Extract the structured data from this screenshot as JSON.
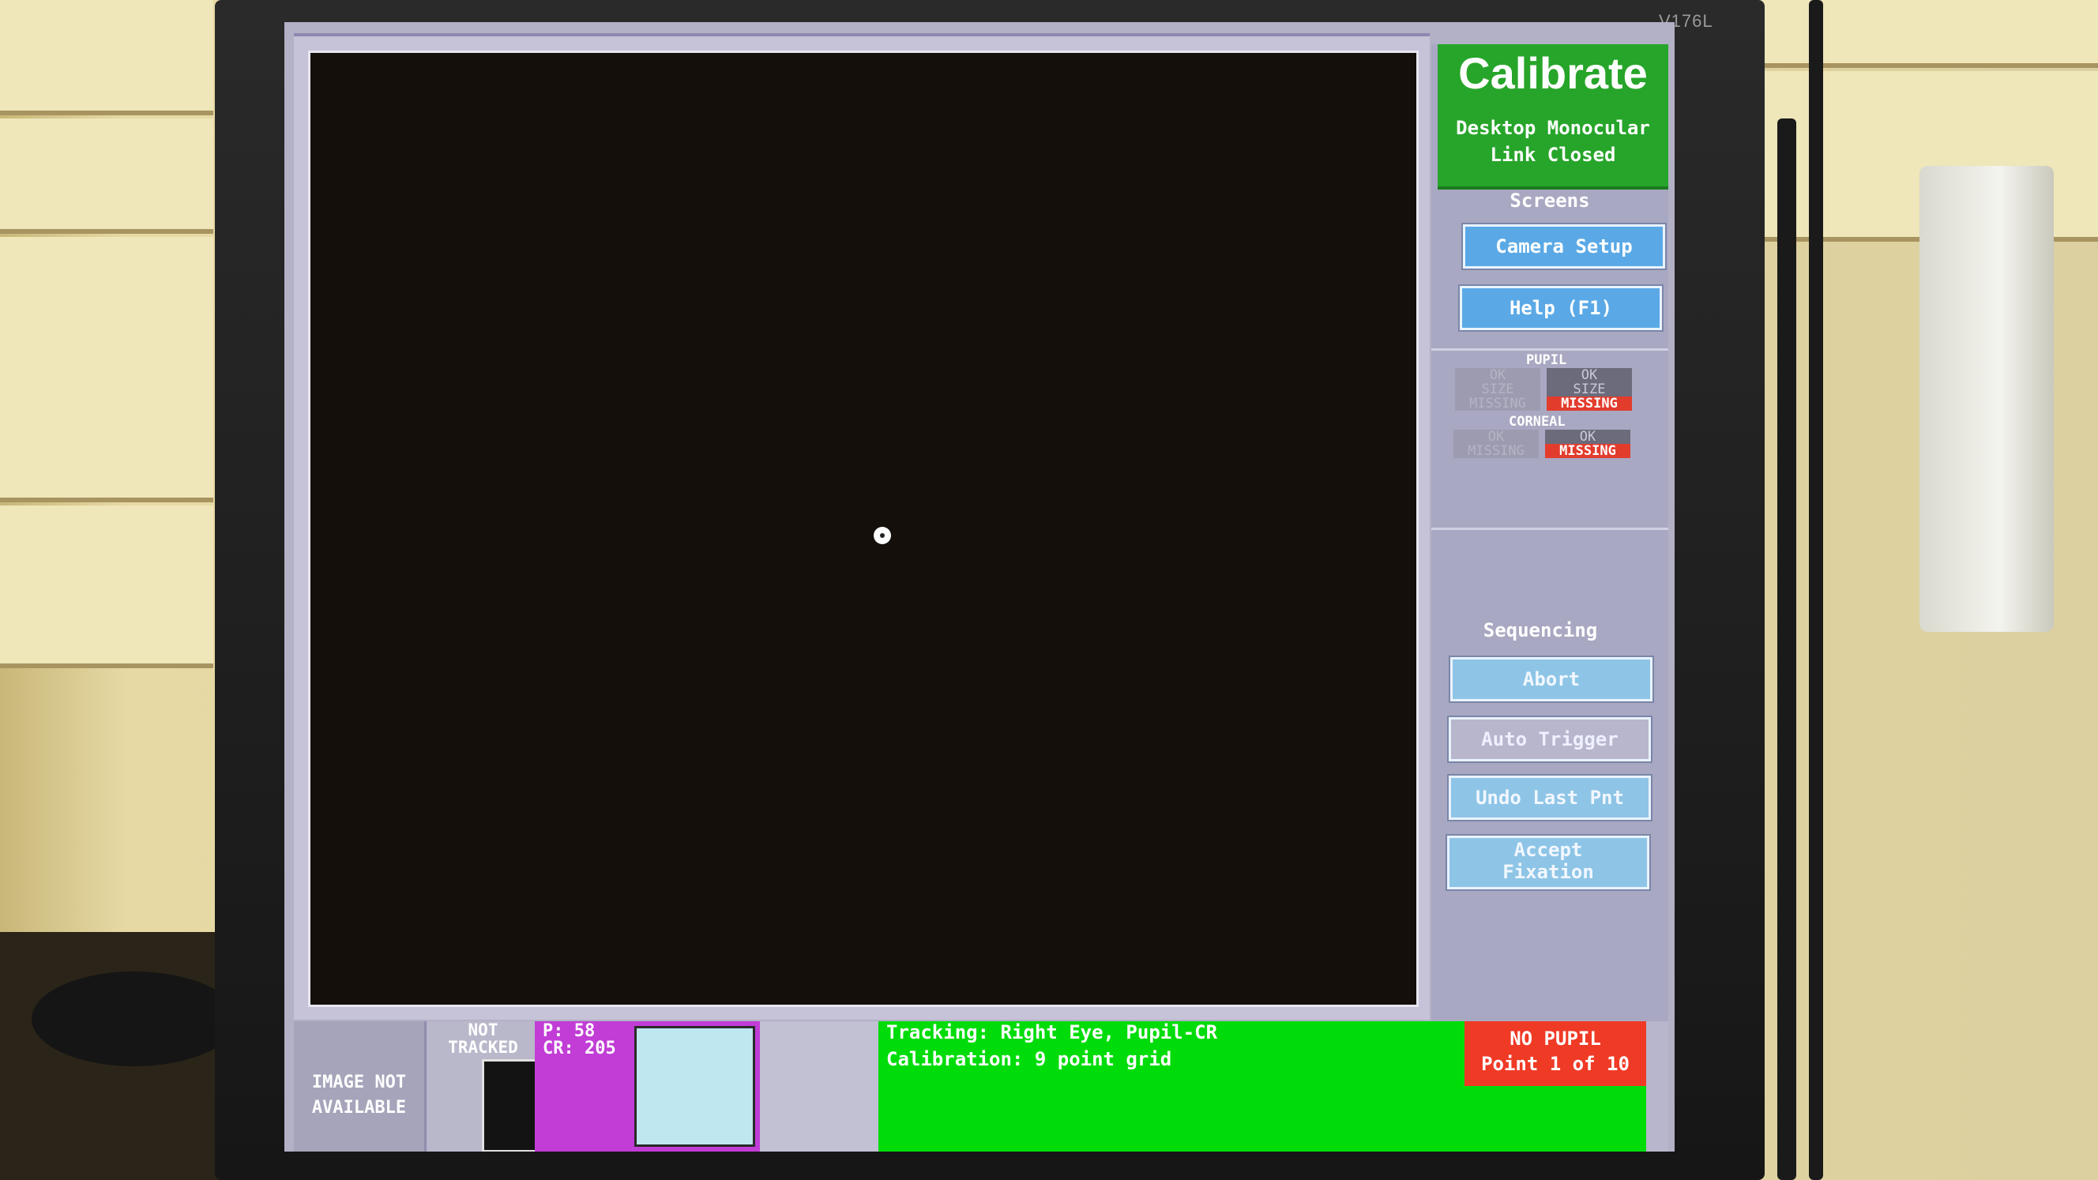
{
  "monitor": {
    "brand": "V176L"
  },
  "panel": {
    "title": "Calibrate",
    "mode": "Desktop Monocular",
    "link_status": "Link Closed",
    "screens_label": "Screens",
    "screens_buttons": [
      "Camera Setup",
      "Help (F1)"
    ],
    "pupil_label": "PUPIL",
    "pupil_left": [
      "OK",
      "SIZE",
      "MISSING"
    ],
    "pupil_right": [
      "OK",
      "SIZE",
      "MISSING"
    ],
    "corneal_label": "CORNEAL",
    "corneal_left": [
      "OK",
      "MISSING"
    ],
    "corneal_right": [
      "OK",
      "MISSING"
    ],
    "sequencing_label": "Sequencing",
    "sequencing_buttons": {
      "abort": "Abort",
      "auto_trigger": "Auto Trigger",
      "undo_last": "Undo Last Pnt",
      "accept_fixation_1": "Accept",
      "accept_fixation_2": "Fixation"
    }
  },
  "bottom_bar": {
    "image_status_1": "IMAGE NOT",
    "image_status_2": "AVAILABLE",
    "tracked_1": "NOT",
    "tracked_2": "TRACKED",
    "p_value": "P:  58",
    "cr_value": "CR: 205",
    "tracking": "Tracking:  Right Eye, Pupil-CR",
    "calibration": "Calibration: 9 point grid",
    "warning_1": "NO PUPIL",
    "warning_2": "Point 1 of 10"
  },
  "colors": {
    "title_green": "#27a52a",
    "status_green": "#00dc0a",
    "warning_red": "#ef3a26",
    "button_blue": "#5aa9e6",
    "threshold_magenta": "#c13dd6"
  }
}
